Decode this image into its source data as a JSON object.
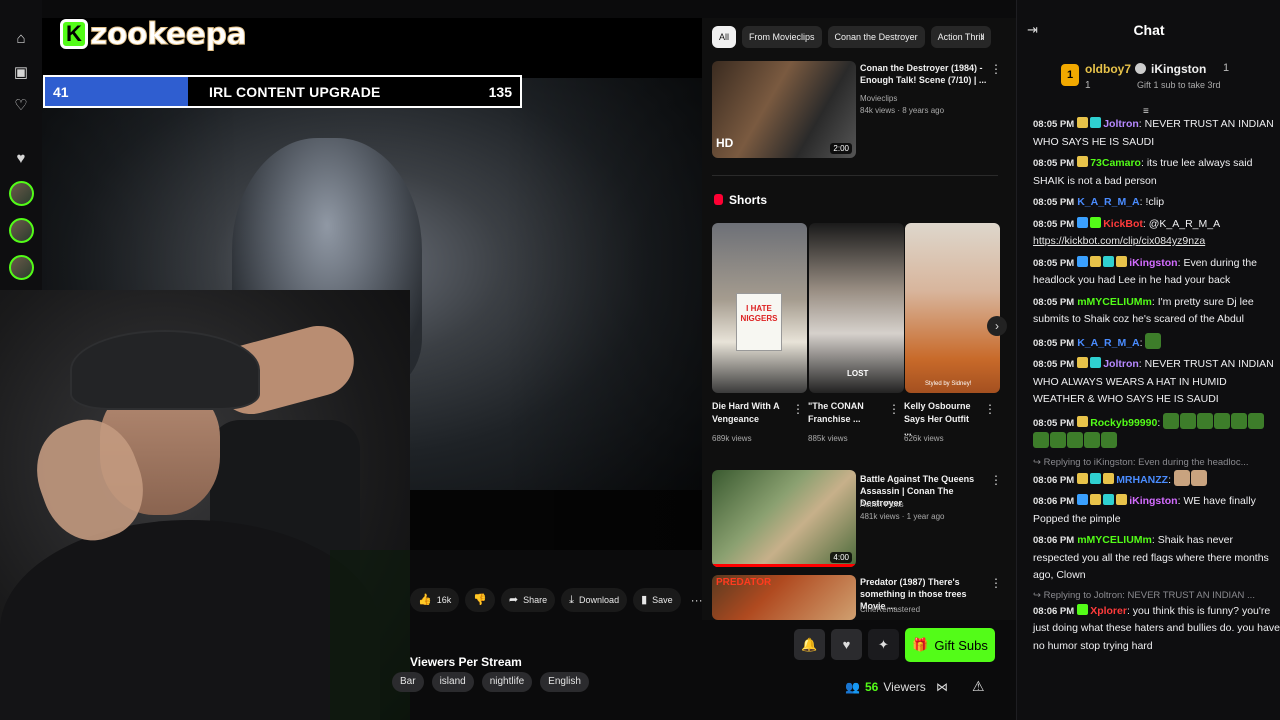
{
  "rail": {
    "icons": [
      "home-icon",
      "following-icon",
      "heart-icon",
      "heart-filled-icon"
    ],
    "avatars": 5
  },
  "logo": {
    "letter": "K",
    "name": "zookeepa"
  },
  "upgrade_bar": {
    "left_value": "41",
    "title": "IRL CONTENT UPGRADE",
    "right_value": "135",
    "progress": 0.3
  },
  "youtube": {
    "chips": [
      {
        "label": "All",
        "active": true
      },
      {
        "label": "From Movieclips",
        "active": false
      },
      {
        "label": "Conan the Destroyer",
        "active": false
      },
      {
        "label": "Action Thrill",
        "active": false
      }
    ],
    "video1": {
      "title": "Conan the Destroyer (1984) - Enough Talk! Scene (7/10) | ...",
      "channel": "Movieclips",
      "meta": "84k views · 8 years ago",
      "badge": "HD",
      "duration": "2:00"
    },
    "shorts_heading": "Shorts",
    "shorts": [
      {
        "title": "Die Hard With A Vengeance",
        "views": "689k views",
        "sign": "I HATE NIGGERS"
      },
      {
        "title": "\"The CONAN Franchise ...",
        "views": "885k views",
        "overlay": "LOST"
      },
      {
        "title": "Kelly Osbourne Says Her Outfit ...",
        "views": "626k views",
        "overlay": "Styled by Sidney!"
      }
    ],
    "video2": {
      "title": "Battle Against The Queens Assassin | Conan The Destroyer",
      "channel": "Action Picks",
      "meta": "481k views · 1 year ago",
      "duration": "4:00"
    },
    "video3": {
      "title": "Predator (1987) There's something in those trees Movie ...",
      "channel": "CineRemastered",
      "thumb_text": "PREDATOR"
    }
  },
  "actions": {
    "like": "16k",
    "share": "Share",
    "download": "Download",
    "save": "Save"
  },
  "stream": {
    "category": "Viewers Per Stream",
    "tags": [
      "Bar",
      "island",
      "nightlife",
      "English"
    ],
    "viewers": "56",
    "viewers_label": "Viewers",
    "gift_label": "Gift Subs"
  },
  "chat": {
    "title": "Chat",
    "gifter1": {
      "rank": "1",
      "name": "oldboy7",
      "count": "1"
    },
    "gifter2": {
      "name": "iKingston",
      "count": "1"
    },
    "gift_note": "Gift 1 sub to take 3rd",
    "messages": [
      {
        "time": "08:05 PM",
        "user": "Joltron",
        "color": "#b689ff",
        "badges": [
          "#e8c34a",
          "#2fd0d0"
        ],
        "text": "NEVER TRUST AN INDIAN WHO SAYS HE IS SAUDI"
      },
      {
        "time": "08:05 PM",
        "user": "73Camaro",
        "color": "#53fc18",
        "badges": [
          "#e8c34a"
        ],
        "text": "its true lee always said SHAIK is not a bad person"
      },
      {
        "time": "08:05 PM",
        "user": "K_A_R_M_A",
        "color": "#4a8cff",
        "badges": [],
        "text": "!clip"
      },
      {
        "time": "08:05 PM",
        "user": "KickBot",
        "color": "#ff3b3b",
        "badges": [
          "#3aa0ff",
          "#53fc18"
        ],
        "text": "@K_A_R_M_A",
        "link": "https://kickbot.com/clip/cix084yz9nza"
      },
      {
        "time": "08:05 PM",
        "user": "iKingston",
        "color": "#d36cff",
        "badges": [
          "#3aa0ff",
          "#e8c34a",
          "#2fd0d0",
          "#e8c34a"
        ],
        "text": "Even during the headlock you had Lee in he had your back"
      },
      {
        "time": "08:05 PM",
        "user": "mMYCELIUMm",
        "color": "#53fc18",
        "badges": [],
        "text": "I'm pretty sure Dj lee submits to Shaik coz he's scared of the Abdul"
      },
      {
        "time": "08:05 PM",
        "user": "K_A_R_M_A",
        "color": "#4a8cff",
        "badges": [],
        "text": "",
        "emotes": 1
      },
      {
        "time": "08:05 PM",
        "user": "Joltron",
        "color": "#b689ff",
        "badges": [
          "#e8c34a",
          "#2fd0d0"
        ],
        "text": "NEVER TRUST AN INDIAN WHO ALWAYS WEARS A HAT IN HUMID WEATHER & WHO SAYS HE IS SAUDI"
      },
      {
        "time": "08:05 PM",
        "user": "Rockyb99990",
        "color": "#53fc18",
        "badges": [
          "#e8c34a"
        ],
        "text": "",
        "emotes": 11
      },
      {
        "reply": "Replying to iKingston: Even during the headloc..."
      },
      {
        "time": "08:06 PM",
        "user": "MRHANZZ",
        "color": "#4a8cff",
        "badges": [
          "#e8c34a",
          "#2fd0d0",
          "#e8c34a"
        ],
        "text": "",
        "emotes2": 2
      },
      {
        "time": "08:06 PM",
        "user": "iKingston",
        "color": "#d36cff",
        "badges": [
          "#3aa0ff",
          "#e8c34a",
          "#2fd0d0",
          "#e8c34a"
        ],
        "text": "WE have finally Popped the pimple"
      },
      {
        "time": "08:06 PM",
        "user": "mMYCELIUMm",
        "color": "#53fc18",
        "badges": [],
        "text": "Shaik has never respected you all the red flags where there months ago, Clown"
      },
      {
        "reply": "Replying to Joltron: NEVER TRUST AN INDIAN ..."
      },
      {
        "time": "08:06 PM",
        "user": "Xplorer",
        "color": "#ff3b3b",
        "badges": [
          "#53fc18"
        ],
        "text": "you think this is funny? you're just doing what these haters and bullies do. you have no humor stop trying hard"
      }
    ]
  }
}
